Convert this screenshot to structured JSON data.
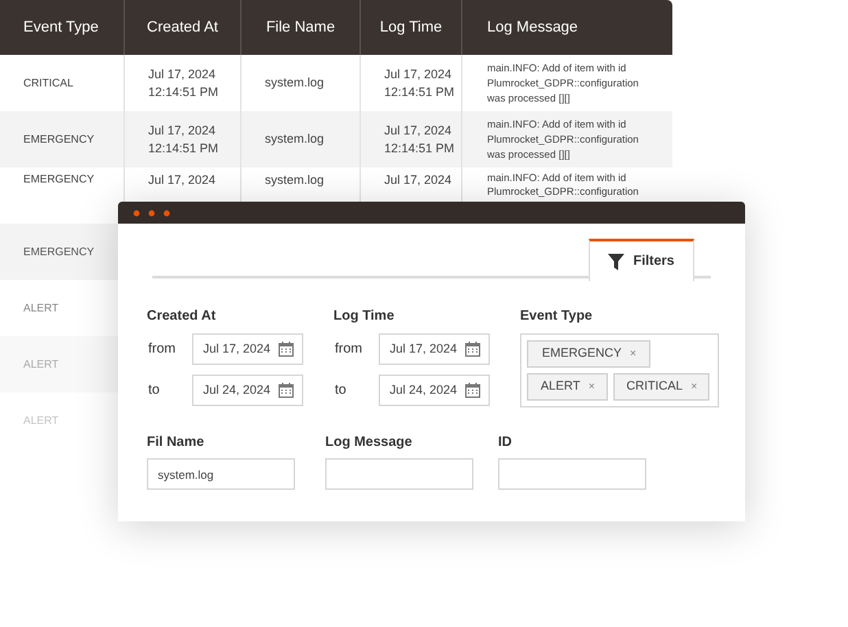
{
  "table": {
    "columns": [
      "Event Type",
      "Created At",
      "File Name",
      "Log Time",
      "Log Message"
    ],
    "rows": [
      {
        "cells": [
          "CRITICAL",
          "Jul 17, 2024\n12:14:51 PM",
          "system.log",
          "Jul 17, 2024\n12:14:51 PM",
          "main.INFO: Add of item with id\nPlumrocket_GDPR::configuration\nwas processed [][]"
        ]
      },
      {
        "cells": [
          "EMERGENCY",
          "Jul 17, 2024\n12:14:51 PM",
          "system.log",
          "Jul 17, 2024\n12:14:51 PM",
          "main.INFO: Add of item with id\nPlumrocket_GDPR::configuration\nwas processed [][]"
        ]
      },
      {
        "cells": [
          "EMERGENCY",
          "Jul 17, 2024",
          "system.log",
          "Jul 17, 2024",
          "main.INFO: Add of item with id\nPlumrocket_GDPR::configuration"
        ]
      },
      {
        "cells": [
          "EMERGENCY"
        ]
      },
      {
        "cells": [
          "ALERT"
        ]
      },
      {
        "cells": [
          "ALERT"
        ]
      },
      {
        "cells": [
          "ALERT"
        ]
      }
    ]
  },
  "filters_panel": {
    "tab": {
      "label": "Filters",
      "selected": true
    },
    "date_ranges": [
      {
        "label": "Created At",
        "from_label": "from",
        "from": "Jul 17, 2024",
        "to_label": "to",
        "to": "Jul 24, 2024"
      },
      {
        "label": "Log Time",
        "from_label": "from",
        "from": "Jul 17, 2024",
        "to_label": "to",
        "to": "Jul 24, 2024"
      }
    ],
    "event_type": {
      "label": "Event Type",
      "tags": [
        "EMERGENCY",
        "ALERT",
        "CRITICAL"
      ],
      "remove_glyph": "×"
    },
    "text_fields": [
      {
        "label": "Fil Name",
        "value": "system.log"
      },
      {
        "label": "Log Message"
      },
      {
        "label": "ID"
      }
    ]
  }
}
